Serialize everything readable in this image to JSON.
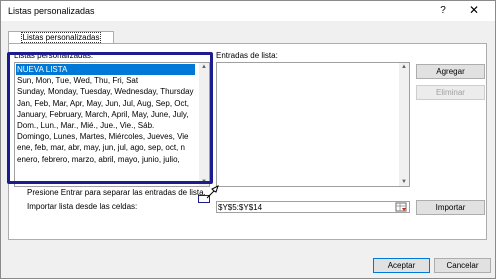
{
  "window": {
    "title": "Listas personalizadas",
    "help": "?",
    "close": "✕"
  },
  "tab": {
    "label": "Listas personalizadas"
  },
  "custom_lists": {
    "label": "Listas personalizadas:",
    "items": [
      "NUEVA LISTA",
      "Sun, Mon, Tue, Wed, Thu, Fri, Sat",
      "Sunday, Monday, Tuesday, Wednesday, Thursday",
      "Jan, Feb, Mar, Apr, May, Jun, Jul, Aug, Sep, Oct,",
      "January, February, March, April, May, June, July,",
      "Dom., Lun., Mar., Mié., Jue., Vie., Sáb.",
      "Domingo, Lunes, Martes, Miércoles, Jueves, Vie",
      "ene, feb, mar, abr, may, jun, jul, ago, sep, oct, n",
      "enero, febrero, marzo, abril, mayo, junio, julio,"
    ],
    "selected_index": 0
  },
  "entries": {
    "label": "Entradas de lista:"
  },
  "buttons": {
    "add": "Agregar",
    "delete": "Eliminar",
    "import": "Importar",
    "accept": "Aceptar",
    "cancel": "Cancelar"
  },
  "hint": "Presione Entrar para separar las entradas de lista.",
  "import_from": {
    "label": "Importar lista desde las celdas:",
    "value": "$Y$5:$Y$14"
  },
  "colors": {
    "accent": "#0078d7",
    "highlight_border": "#1c1c8f"
  }
}
